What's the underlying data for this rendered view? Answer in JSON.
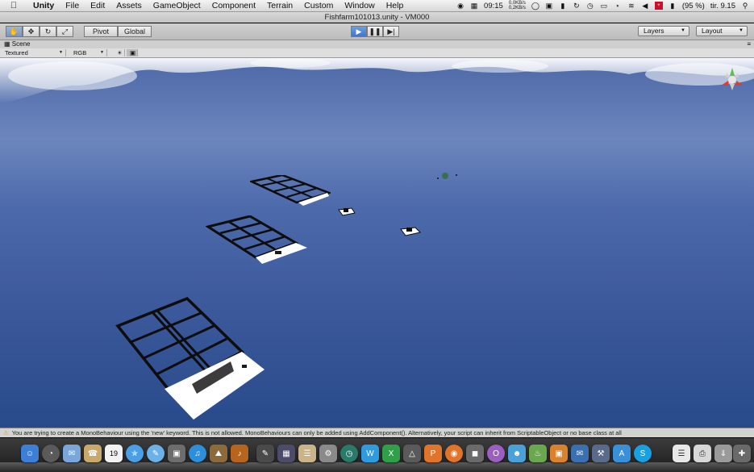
{
  "menubar": {
    "app": "Unity",
    "items": [
      "File",
      "Edit",
      "Assets",
      "GameObject",
      "Component",
      "Terrain",
      "Custom",
      "Window",
      "Help"
    ],
    "time_small": "09:15",
    "net_down": "0,0KB/s",
    "net_up": "0,2KB/s",
    "battery": "(95 %)",
    "clock": "tir. 9.15"
  },
  "window": {
    "title": "Fishfarm101013.unity - VM000"
  },
  "toolbar": {
    "pivot_label": "Pivot",
    "global_label": "Global",
    "layers_label": "Layers",
    "layout_label": "Layout"
  },
  "scene": {
    "tab_label": "Scene",
    "render_mode": "Textured",
    "color_mode": "RGB"
  },
  "console": {
    "warning": "You are trying to create a MonoBehaviour using the 'new' keyword.  This is not allowed.  MonoBehaviours can only be added using AddComponent().  Alternatively, your script can inherit from ScriptableObject or no base class at all"
  },
  "dock": {
    "calendar_day": "19"
  },
  "colors": {
    "play_blue": "#3f75c8",
    "platform_white": "#ffffff",
    "net_black": "#0d0d0d"
  }
}
